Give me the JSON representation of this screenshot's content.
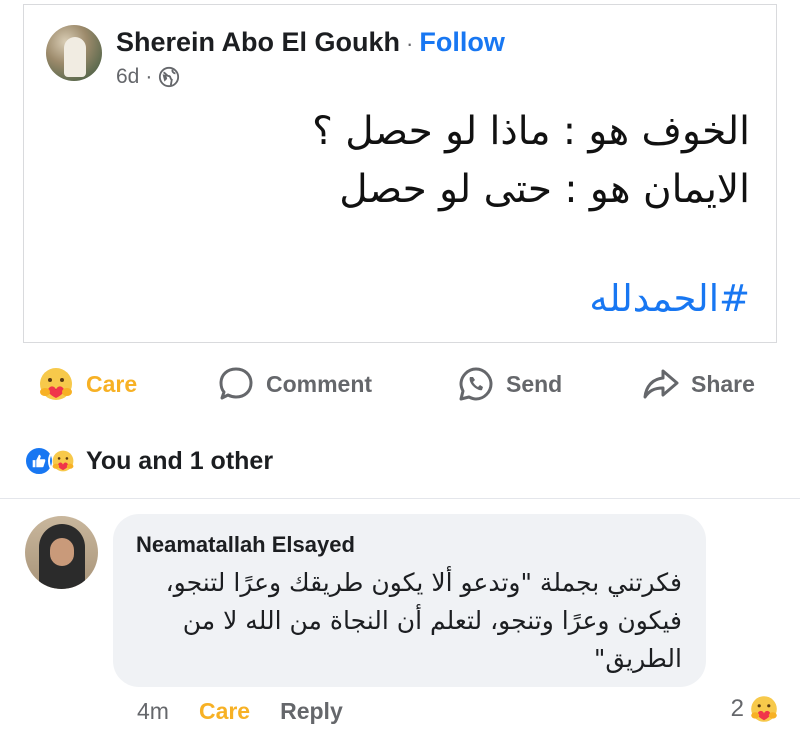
{
  "post": {
    "author": "Sherein Abo El Goukh",
    "separator": "·",
    "follow_label": "Follow",
    "time": "6d",
    "meta_separator": "·",
    "audience_icon": "globe-icon",
    "body_lines": [
      "الخوف هو : ماذا لو حصل ؟",
      "الايمان هو : حتى لو حصل"
    ],
    "hashtag": "#الحمدلله"
  },
  "actions": {
    "care_label": "Care",
    "comment_label": "Comment",
    "send_label": "Send",
    "share_label": "Share"
  },
  "reactions": {
    "icons": [
      "like-icon",
      "care-icon"
    ],
    "summary": "You and 1 other"
  },
  "comment": {
    "author": "Neamatallah Elsayed",
    "text_lines": [
      "فكرتني بجملة \"وتدعو ألا يكون طريقك وعرًا لتنجو،",
      "فيكون وعرًا وتنجو، لتعلم أن النجاة من الله لا من",
      "الطريق\""
    ],
    "time": "4m",
    "care_label": "Care",
    "reply_label": "Reply",
    "reaction_count": "2",
    "reaction_icon": "care-icon"
  },
  "colors": {
    "accent_blue": "#1877f2",
    "care_yellow": "#f7b125",
    "muted_text": "#65676b",
    "bubble_bg": "#f0f2f5"
  }
}
